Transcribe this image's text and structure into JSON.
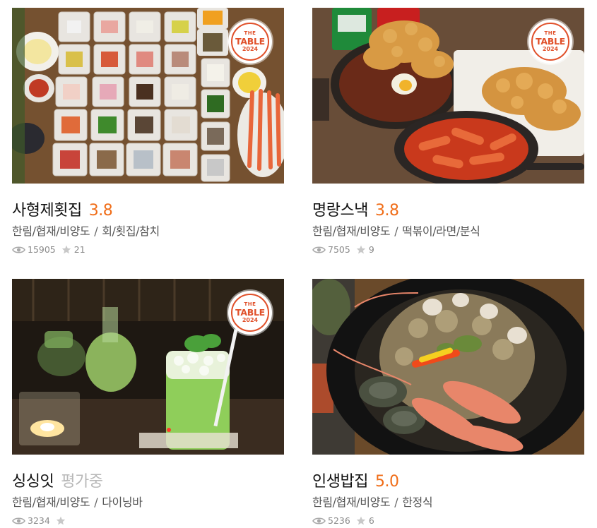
{
  "badge": {
    "line1": "THE",
    "line2": "TABLE",
    "line3": "2024"
  },
  "restaurants": [
    {
      "name": "사형제횟집",
      "rating": "3.8",
      "region": "한림/협재/비양도",
      "category": "회/횟집/참치",
      "views": "15905",
      "reviews": "21",
      "has_badge": true,
      "photo_icon": "seafood-banchan-photo"
    },
    {
      "name": "명랑스낵",
      "rating": "3.8",
      "region": "한림/협재/비양도",
      "category": "떡볶이/라면/분식",
      "views": "7505",
      "reviews": "9",
      "has_badge": true,
      "photo_icon": "tteokbokki-fried-food-photo"
    },
    {
      "name": "싱싱잇",
      "rating": "평가중",
      "region": "한림/협재/비양도",
      "category": "다이닝바",
      "views": "3234",
      "reviews": "",
      "has_badge": true,
      "photo_icon": "green-cocktail-photo"
    },
    {
      "name": "인생밥집",
      "rating": "5.0",
      "region": "한림/협재/비양도",
      "category": "한정식",
      "views": "5236",
      "reviews": "6",
      "has_badge": false,
      "photo_icon": "abalone-shrimp-rice-bowl-photo"
    }
  ],
  "separator": "/",
  "colors": {
    "rating": "#f06d18",
    "pending": "#b8b8b8",
    "badge": "#e0502a",
    "meta": "#8a8a8a"
  }
}
